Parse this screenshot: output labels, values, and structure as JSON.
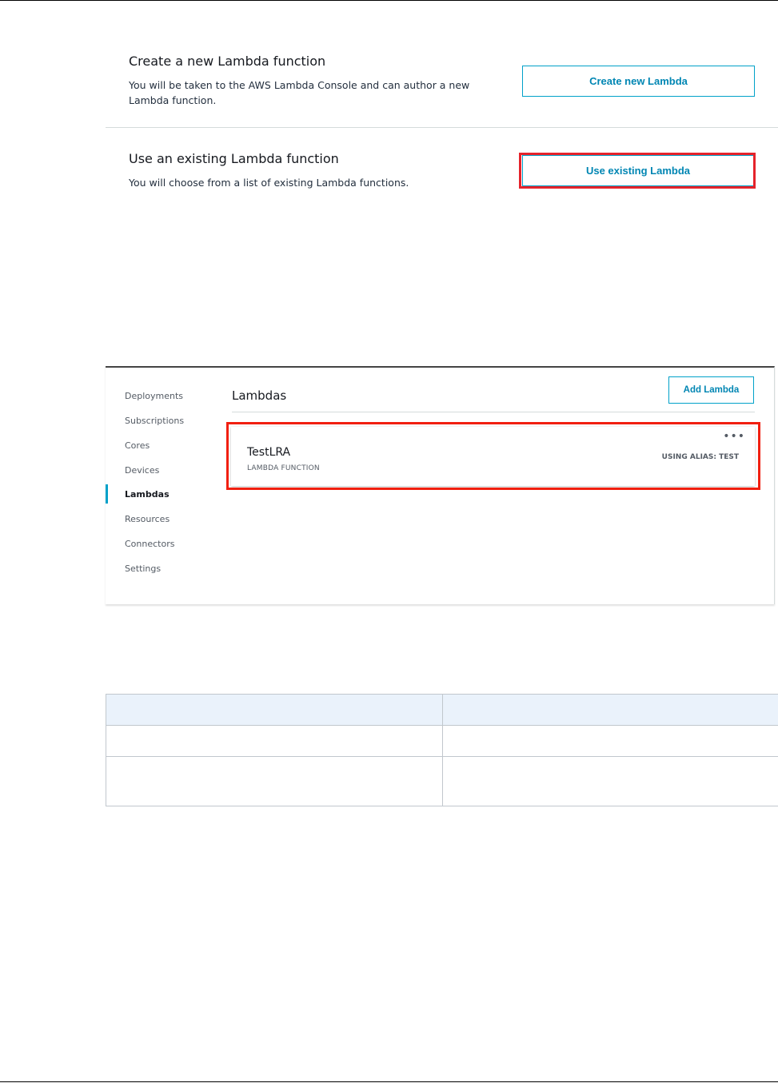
{
  "create_section": {
    "title": "Create a new Lambda function",
    "description": "You will be taken to the AWS Lambda Console and can author a new Lambda function.",
    "button_label": "Create new Lambda"
  },
  "existing_section": {
    "title": "Use an existing Lambda function",
    "description": "You will choose from a list of existing Lambda functions.",
    "button_label": "Use existing Lambda"
  },
  "console": {
    "nav": {
      "items": [
        {
          "label": "Deployments"
        },
        {
          "label": "Subscriptions"
        },
        {
          "label": "Cores"
        },
        {
          "label": "Devices"
        },
        {
          "label": "Lambdas",
          "active": true
        },
        {
          "label": "Resources"
        },
        {
          "label": "Connectors"
        },
        {
          "label": "Settings"
        }
      ]
    },
    "section_title": "Lambdas",
    "add_button_label": "Add Lambda",
    "lambda_card": {
      "name": "TestLRA",
      "type": "LAMBDA FUNCTION",
      "alias": "USING ALIAS: TEST",
      "more": "•••"
    }
  },
  "colors": {
    "accent": "#00a1c9",
    "highlight": "#e5232b",
    "table_header": "#eaf2fb"
  }
}
